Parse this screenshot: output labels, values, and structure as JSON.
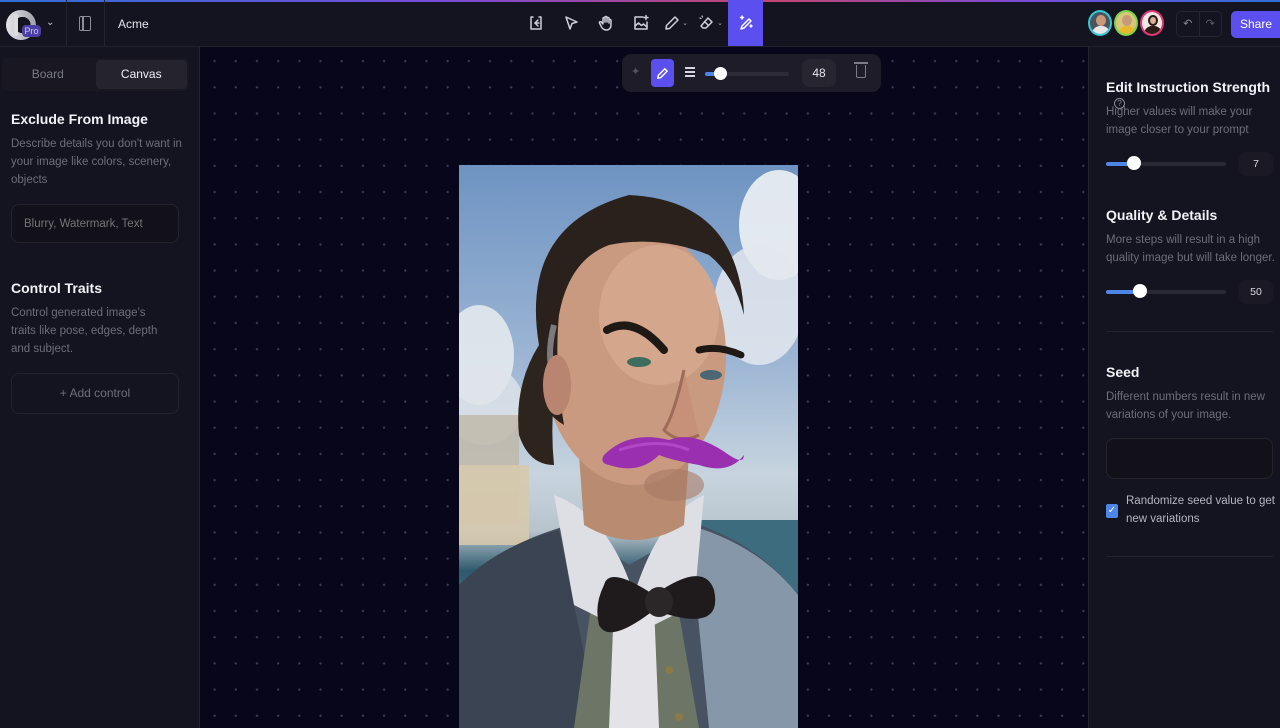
{
  "header": {
    "app_name": "Acme",
    "badge": "Pro",
    "tools": [
      {
        "name": "import-icon",
        "label": "Import",
        "active": false
      },
      {
        "name": "select-icon",
        "label": "Select",
        "active": false
      },
      {
        "name": "hand-icon",
        "label": "Pan",
        "active": false
      },
      {
        "name": "ai-image-icon",
        "label": "Generate image",
        "active": false
      },
      {
        "name": "pencil-icon",
        "label": "Draw",
        "active": false,
        "has_menu": true
      },
      {
        "name": "eraser-icon",
        "label": "Eraser",
        "active": false,
        "has_menu": true
      },
      {
        "name": "magic-pen-icon",
        "label": "Edit instruction brush",
        "active": true
      }
    ],
    "collaborators": [
      {
        "name": "collaborator-1",
        "ring": "#35c9d6"
      },
      {
        "name": "collaborator-2",
        "ring": "#7bd34a"
      },
      {
        "name": "collaborator-3",
        "ring": "#e0356f"
      }
    ],
    "undo_glyph": "↶",
    "redo_glyph": "↷",
    "share_label": "Share",
    "accent": "#5b4ff0"
  },
  "left_panel": {
    "tabs": [
      {
        "label": "Board",
        "active": false
      },
      {
        "label": "Canvas",
        "active": true
      }
    ],
    "exclude": {
      "title": "Exclude From Image",
      "description": "Describe details you don't want in your image like colors, scenery, objects",
      "placeholder": "Blurry, Watermark, Text",
      "value": ""
    },
    "control_traits": {
      "title": "Control Traits",
      "description": "Control generated image's traits like pose, edges, depth and subject.",
      "add_label": "+ Add control"
    }
  },
  "canvas": {
    "brush_toolbar": {
      "brush_size": 48,
      "brush_size_fraction": 0.18
    },
    "image_alt": "Painted portrait of a man with curly dark hair, purple mustache, black bow tie and grey suit by the sea"
  },
  "right_panel": {
    "strength": {
      "title": "Edit Instruction Strength",
      "help": "?",
      "description": "Higher values will make your image closer to your prompt",
      "value": "7",
      "fraction": 0.23
    },
    "quality": {
      "title": "Quality & Details",
      "description": "More steps will result in a high quality image but will take longer.",
      "value": "50",
      "fraction": 0.28
    },
    "seed": {
      "title": "Seed",
      "description": "Different numbers result in new variations of your image.",
      "value": "",
      "randomize_checked": true,
      "randomize_label": "Randomize seed value to get new variations"
    },
    "slider_color": "#4d86e8"
  }
}
